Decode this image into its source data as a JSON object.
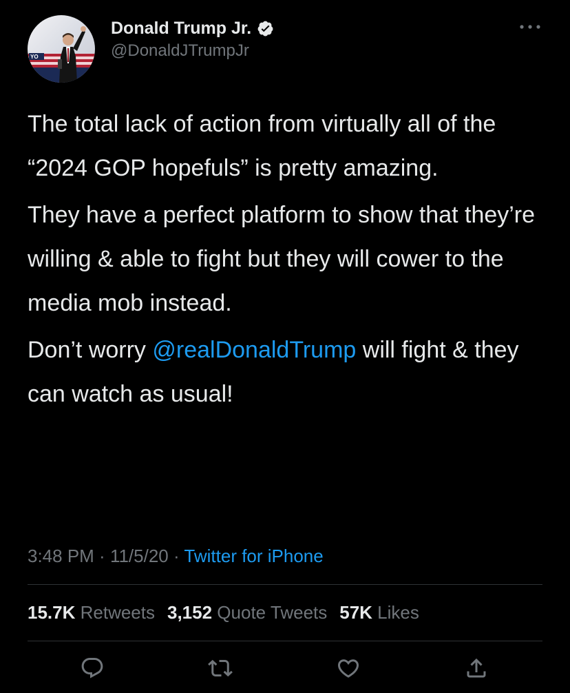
{
  "author": {
    "name": "Donald Trump Jr.",
    "handle": "@DonaldJTrumpJr",
    "verified_icon": "verified-badge-icon",
    "more_icon": "more-options-icon"
  },
  "tweet": {
    "paragraph_1": "The total lack of action from virtually all of the “2024 GOP hopefuls” is pretty amazing.",
    "paragraph_2": "They have a perfect platform to show that they’re willing & able to fight but they will cower to the media mob instead.",
    "paragraph_3_before": "Don’t worry ",
    "paragraph_3_mention": "@realDonaldTrump",
    "paragraph_3_after": " will fight & they can watch as usual!"
  },
  "meta": {
    "time": "3:48 PM",
    "separator": " · ",
    "date": "11/5/20",
    "source": "Twitter for iPhone"
  },
  "stats": {
    "retweets_count": "15.7K",
    "retweets_label": " Retweets",
    "quotes_count": "3,152",
    "quotes_label": " Quote Tweets",
    "likes_count": "57K",
    "likes_label": " Likes"
  },
  "actions": {
    "reply_icon": "reply-icon",
    "retweet_icon": "retweet-icon",
    "like_icon": "heart-icon",
    "share_icon": "share-icon"
  },
  "colors": {
    "background": "#000000",
    "text": "#e7e9ea",
    "secondary": "#71767b",
    "link": "#1d9bf0",
    "divider": "#2f3336"
  }
}
